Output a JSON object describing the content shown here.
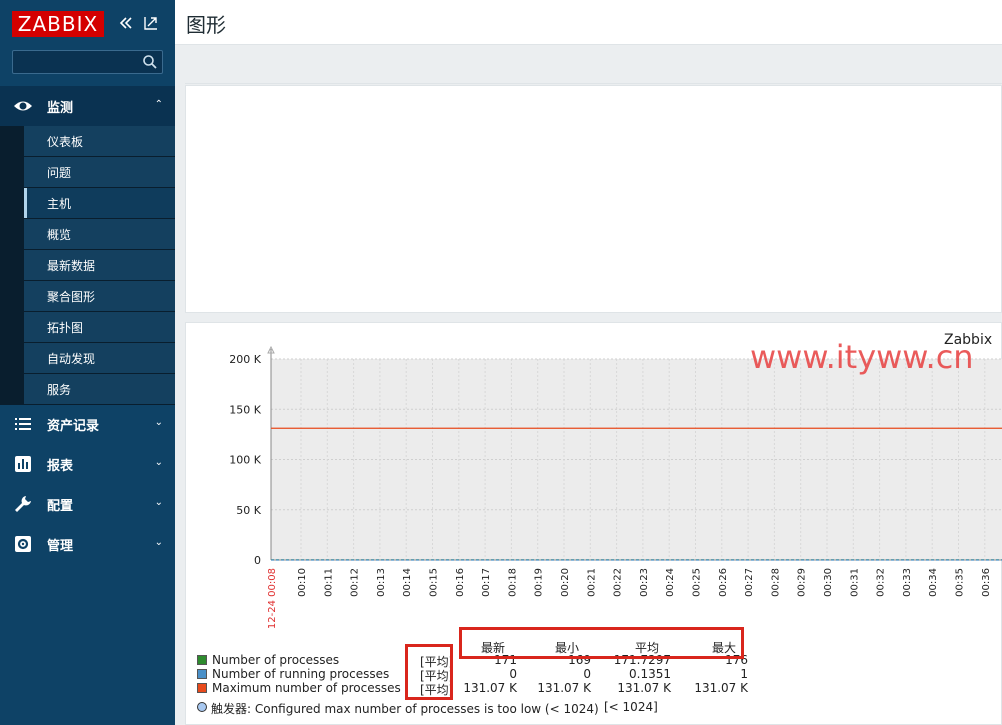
{
  "sidebar": {
    "logo": "ZABBIX",
    "collapse_icon": "double-chevron-left-icon",
    "kiosk_icon": "fullscreen-icon",
    "search": {
      "placeholder": "",
      "value": ""
    },
    "menu": [
      {
        "label": "监测",
        "icon": "eye-icon",
        "expanded": true,
        "items": [
          "仪表板",
          "问题",
          "主机",
          "概览",
          "最新数据",
          "聚合图形",
          "拓扑图",
          "自动发现",
          "服务"
        ],
        "active_item": "主机"
      },
      {
        "label": "资产记录",
        "icon": "list-icon"
      },
      {
        "label": "报表",
        "icon": "bar-chart-icon"
      },
      {
        "label": "配置",
        "icon": "wrench-icon"
      },
      {
        "label": "管理",
        "icon": "gear-icon"
      }
    ]
  },
  "page": {
    "title": "图形"
  },
  "watermark": "www.ityww.cn",
  "chart_data": {
    "type": "line",
    "title": "Zabbix",
    "y_ticks": [
      "200 K",
      "150 K",
      "100 K",
      "50 K",
      "0"
    ],
    "ylim": [
      0,
      200000
    ],
    "x_start_label": "12-24 00:08",
    "x_ticks": [
      "00:10",
      "00:11",
      "00:12",
      "00:13",
      "00:14",
      "00:15",
      "00:16",
      "00:17",
      "00:18",
      "00:19",
      "00:20",
      "00:21",
      "00:22",
      "00:23",
      "00:24",
      "00:25",
      "00:26",
      "00:27",
      "00:28",
      "00:29",
      "00:30",
      "00:31",
      "00:32",
      "00:33",
      "00:34",
      "00:35",
      "00:36"
    ],
    "grid": true,
    "series": [
      {
        "name": "Number of processes",
        "color": "#2e8b2e",
        "value": 171
      },
      {
        "name": "Number of running processes",
        "color": "#4a90c8",
        "value": 0
      },
      {
        "name": "Maximum number of processes",
        "color": "#e84a1c",
        "value": 131070
      }
    ]
  },
  "legend": {
    "headers": [
      "最新",
      "最小",
      "平均",
      "最大"
    ],
    "rows": [
      {
        "name": "Number of processes",
        "func": "[平均]",
        "last": "171",
        "min": "169",
        "avg": "171.7297",
        "max": "176",
        "color": "#2e8b2e"
      },
      {
        "name": "Number of running processes",
        "func": "[平均]",
        "last": "0",
        "min": "0",
        "avg": "0.1351",
        "max": "1",
        "color": "#4a90c8"
      },
      {
        "name": "Maximum number of processes",
        "func": "[平均]",
        "last": "131.07 K",
        "min": "131.07 K",
        "avg": "131.07 K",
        "max": "131.07 K",
        "color": "#e84a1c"
      }
    ],
    "trigger": {
      "prefix": "触发器:",
      "text": "Configured max number of processes is too low (< 1024)",
      "threshold": "[< 1024]"
    }
  }
}
